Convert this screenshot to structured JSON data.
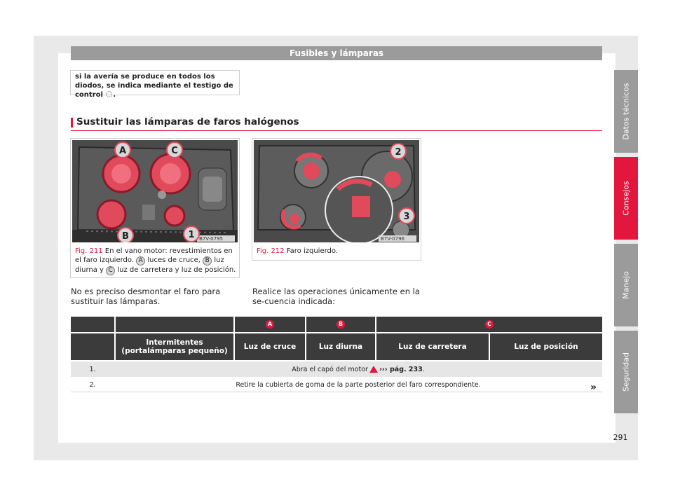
{
  "header": {
    "title": "Fusibles y lámparas"
  },
  "note": {
    "text_before_icon": "si la avería se produce en todos los diodos, se indica mediante el testigo de control",
    "text_after_icon": "."
  },
  "section": {
    "title": "Sustituir las lámparas de faros halógenos"
  },
  "figure1": {
    "code": "B7V-0795",
    "labels": [
      "A",
      "C",
      "B",
      "1"
    ],
    "caption_num": "Fig. 211",
    "caption_part1": "En el vano motor: revestimientos en el faro izquierdo.",
    "label_a": "A",
    "caption_part2": "luces de cruce,",
    "label_b": "B",
    "caption_part3": "luz diurna y",
    "label_c": "C",
    "caption_part4": "luz de carretera y luz de posición."
  },
  "figure2": {
    "code": "B7V-0796",
    "labels": [
      "2",
      "3"
    ],
    "caption_num": "Fig. 212",
    "caption_text": "Faro izquierdo."
  },
  "body": {
    "col1": "No es preciso desmontar el faro para sustituir las lámparas.",
    "col2": "Realice las operaciones únicamente en la se-cuencia indicada:"
  },
  "table": {
    "group_headers": [
      "A",
      "B",
      "C"
    ],
    "col_headers": [
      "Intermitentes (portalámparas pequeño)",
      "Luz de cruce",
      "Luz diurna",
      "Luz de carretera",
      "Luz de posición"
    ],
    "rows": [
      {
        "num": "1.",
        "text_before": "Abra el capó del motor",
        "ref": "››› pág. 233",
        "text_after": "."
      },
      {
        "num": "2.",
        "text": "Retire la cubierta de goma de la parte posterior del faro correspondiente."
      }
    ],
    "continue_mark": "»"
  },
  "side_tabs": [
    "Datos técnicos",
    "Consejos",
    "Manejo",
    "Seguridad"
  ],
  "page_number": "291",
  "colors": {
    "accent": "#e3173e",
    "header_gray": "#9b9b9b",
    "table_dark": "#3b3b3b"
  },
  "icons": [
    "control-light-icon",
    "warning-triangle-icon"
  ]
}
